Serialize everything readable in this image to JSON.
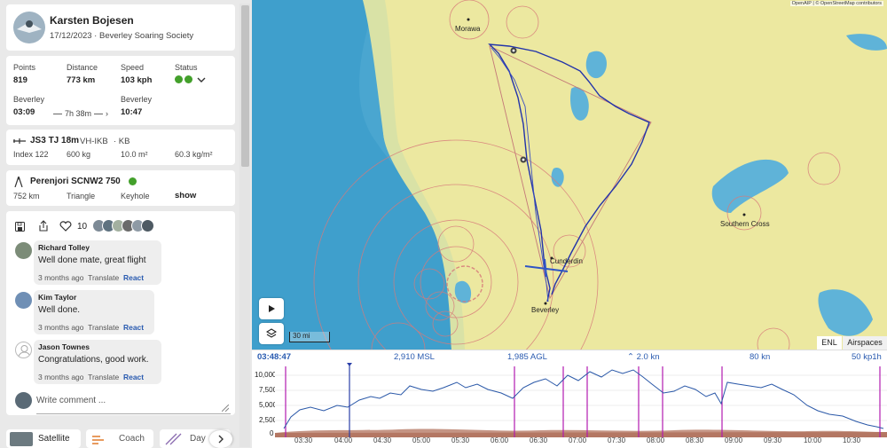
{
  "pilot": {
    "name": "Karsten Bojesen",
    "date_club": "17/12/2023 · Beverley Soaring Society"
  },
  "stats": {
    "points_label": "Points",
    "points": "819",
    "distance_label": "Distance",
    "distance": "773 km",
    "speed_label": "Speed",
    "speed": "103 kph",
    "status_label": "Status",
    "start_place": "Beverley",
    "start_time": "03:09",
    "duration": "7h 38m",
    "end_place": "Beverley",
    "end_time": "10:47"
  },
  "glider": {
    "model": "JS3 TJ 18m",
    "reg": "VH-IKB",
    "cn": "· KB",
    "index": "Index 122",
    "weight": "600 kg",
    "area": "10.0 m²",
    "wing_loading": "60.3 kg/m²"
  },
  "task": {
    "name": "Perenjori SCNW2 750",
    "distance": "752 km",
    "type": "Triangle",
    "sector": "Keyhole",
    "show_label": "show"
  },
  "social": {
    "likes": "10"
  },
  "comments": [
    {
      "author": "Richard Tolley",
      "text": "Well done mate, great flight",
      "age": "3 months ago",
      "translate": "Translate",
      "react": "React"
    },
    {
      "author": "Kim Taylor",
      "text": "Well done.",
      "age": "3 months ago",
      "translate": "Translate",
      "react": "React"
    },
    {
      "author": "Jason Townes",
      "text": "Congratulations, good work.",
      "age": "3 months ago",
      "translate": "Translate",
      "react": "React"
    }
  ],
  "comment_box": {
    "placeholder": "Write comment ..."
  },
  "bottom_tabs": {
    "satellite": "Satellite",
    "coach": "Coach",
    "day": "Day"
  },
  "map": {
    "attribution": "OpenAIP | © OpenStreetMap contributors",
    "places": {
      "morawa": "Morawa",
      "cunderdin": "Cunderdin",
      "beverley": "Beverley",
      "southern_cross": "Southern Cross"
    },
    "scale": "30 mi",
    "tab_enl": "ENL",
    "tab_airspaces": "Airspaces"
  },
  "barogram": {
    "time": "03:48:47",
    "msl": "2,910 MSL",
    "agl": "1,985 AGL",
    "vario": "2.0 kn",
    "speed": "80 kn",
    "wind": "50 kp1h",
    "y_ticks": [
      "10,000",
      "7,500",
      "5,000",
      "2,500",
      "0"
    ],
    "x_ticks": [
      "03:30",
      "04:00",
      "04:30",
      "05:00",
      "05:30",
      "06:00",
      "06:30",
      "07:00",
      "07:30",
      "08:00",
      "08:30",
      "09:00",
      "09:30",
      "10:00",
      "10:30"
    ]
  },
  "colors": {
    "accent": "#2a5bb0",
    "status_green": "#43a02b",
    "track": "#2233aa",
    "task_line": "#c77"
  }
}
